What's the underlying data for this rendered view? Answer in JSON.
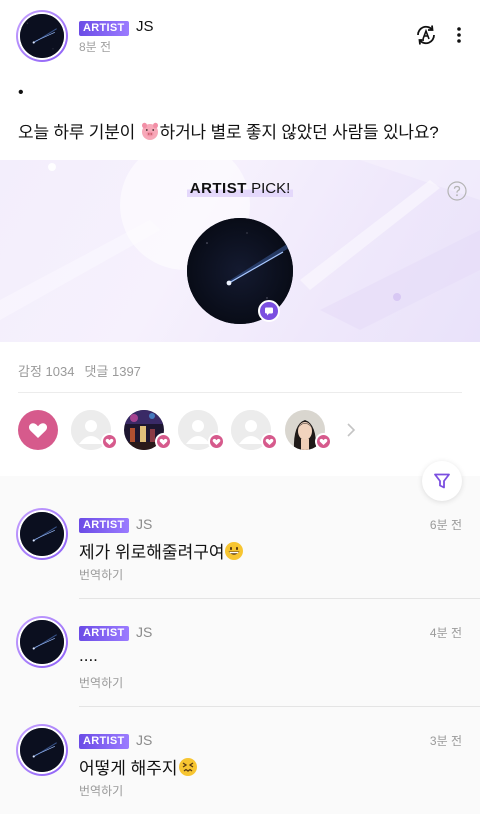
{
  "post": {
    "badge": "ARTIST",
    "author": "JS",
    "time": "8분 전",
    "bullet": "•",
    "text_before": "오늘 하루 기분이 ",
    "text_after": "하거나 별로 좋지 않았던 사람들 있나요?",
    "emoji_icon": "pig-face-emoji"
  },
  "artist_pick": {
    "title_bold": "ARTIST",
    "title_rest": " PICK!",
    "help_icon": "question-circle-icon",
    "chat_icon": "chat-bubble-icon"
  },
  "stats": {
    "reactions": "감정 1034",
    "comments": "댓글 1397"
  },
  "reactors": [
    {
      "type": "default-avatar"
    },
    {
      "type": "concert-photo"
    },
    {
      "type": "default-avatar"
    },
    {
      "type": "default-avatar"
    },
    {
      "type": "woman-photo"
    }
  ],
  "comments": [
    {
      "badge": "ARTIST",
      "author": "JS",
      "time": "6분 전",
      "text": "제가 위로해줄려구여",
      "emoji_icon": "grinning-face-emoji",
      "translate": "번역하기"
    },
    {
      "badge": "ARTIST",
      "author": "JS",
      "time": "4분 전",
      "text": "....",
      "emoji_icon": "",
      "translate": "번역하기"
    },
    {
      "badge": "ARTIST",
      "author": "JS",
      "time": "3분 전",
      "text": "어떻게 해주지",
      "emoji_icon": "confounded-face-emoji",
      "translate": "번역하기"
    }
  ],
  "colors": {
    "accent_purple": "#7b4fe0",
    "heart_pink": "#d65a8c",
    "banner_bg": "#f3eefc"
  }
}
